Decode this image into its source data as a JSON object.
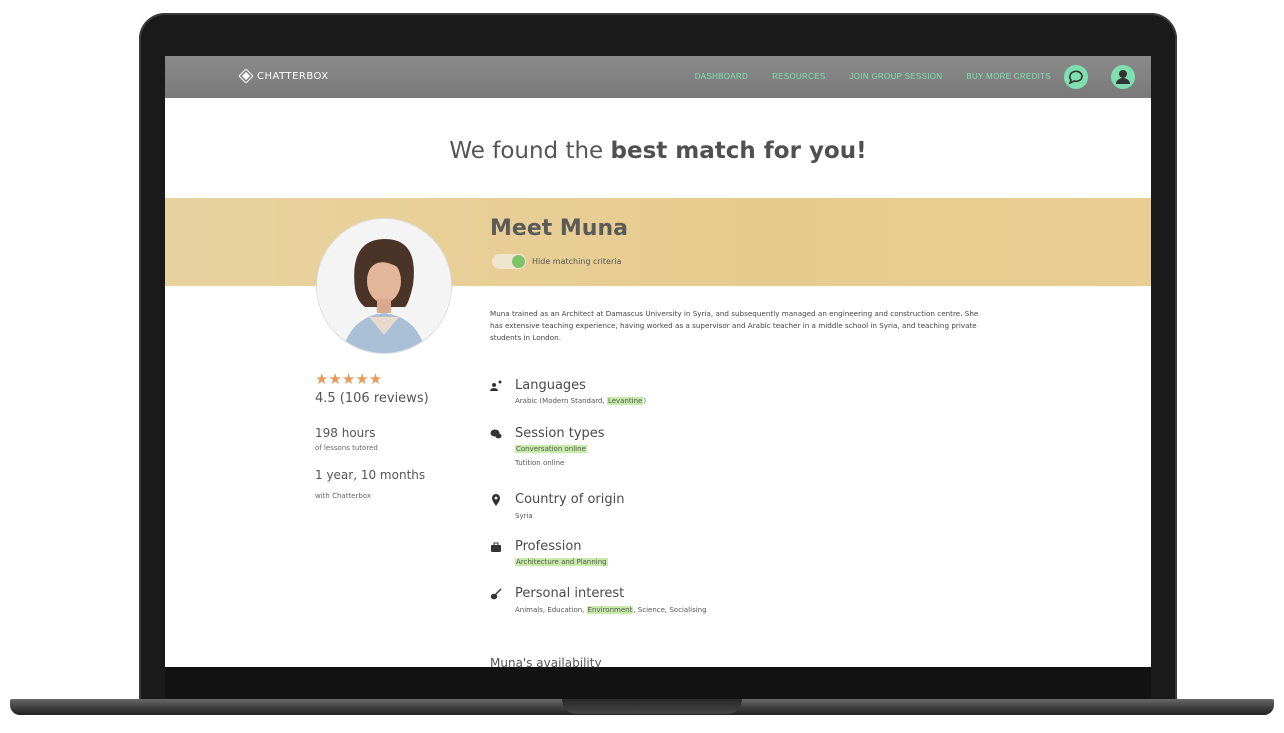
{
  "nav": {
    "brand": "CHATTERBOX",
    "links": [
      "DASHBOARD",
      "RESOURCES",
      "JOIN GROUP SESSION",
      "BUY MORE CREDITS"
    ]
  },
  "headline": {
    "prefix": "We found the ",
    "bold": "best match for you!"
  },
  "tutor": {
    "meet": "Meet Muna",
    "toggle_label": "Hide matching criteria",
    "stars": "★★★★★",
    "rating_text": "4.5 (106 reviews)",
    "rating_value": 4.5,
    "hours": "198 hours",
    "hours_sub": "of lessons tutored",
    "tenure": "1 year, 10 months",
    "tenure_sub": "with Chatterbox",
    "bio": "Muna trained as an Architect at Damascus University in Syria, and subsequently managed an engineering and construction centre. She has extensive teaching experience, having worked as a supervisor and Arabic teacher in a middle school in Syria, and teaching private students in London."
  },
  "criteria": {
    "languages": {
      "title": "Languages",
      "pre": "Arabic (Modern Standard, ",
      "hl": "Levantine",
      "post": ")"
    },
    "sessions": {
      "title": "Session types",
      "hl": "Conversation online",
      "line2": "Tutition online"
    },
    "country": {
      "title": "Country of origin",
      "value": "Syria"
    },
    "profession": {
      "title": "Profession",
      "hl": "Architecture and Planning"
    },
    "interest": {
      "title": "Personal interest",
      "pre": "Animals, Education, ",
      "hl": "Environment",
      "post": ", Science, Socialising"
    }
  },
  "availability_title": "Muna's availability",
  "colors": {
    "accent": "#7ee0b0",
    "band": "#e7cb8e",
    "highlight": "#c7ecaa",
    "stars": "#e69a5c"
  }
}
